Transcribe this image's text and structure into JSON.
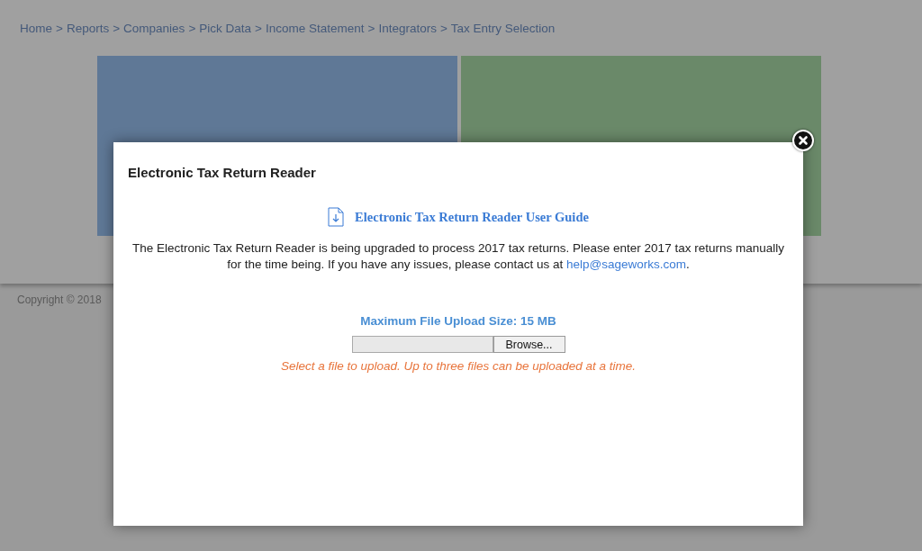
{
  "breadcrumb": {
    "separator": ">",
    "items": [
      "Home",
      "Reports",
      "Companies",
      "Pick Data",
      "Income Statement",
      "Integrators",
      "Tax Entry Selection"
    ]
  },
  "tiles": [
    {
      "color": "#5f7896"
    },
    {
      "color": "#6a8969"
    }
  ],
  "footer": {
    "copyright": "Copyright © 2018"
  },
  "modal": {
    "title": "Electronic Tax Return Reader",
    "guide_link": "Electronic Tax Return Reader User Guide",
    "message": "The Electronic Tax Return Reader is being upgraded to process 2017 tax returns. Please enter 2017 tax returns manually for the time being. If you have any issues, please contact us at ",
    "email": "help@sageworks.com",
    "message_end": ".",
    "upload_limit": "Maximum File Upload Size: 15 MB",
    "browse_button": "Browse...",
    "upload_hint": "Select a file to upload. Up to three files can be uploaded at a time."
  }
}
